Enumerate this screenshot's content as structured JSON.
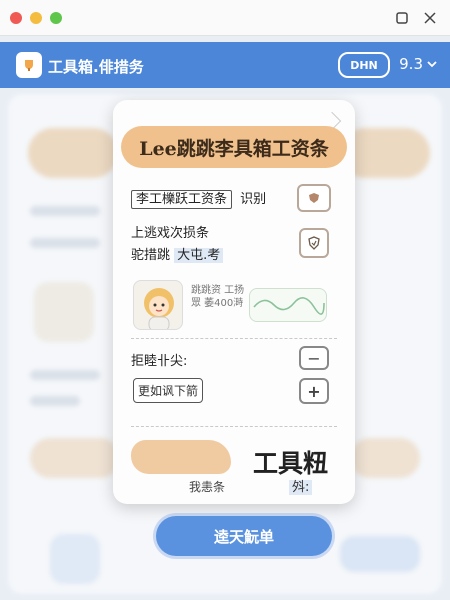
{
  "window": {
    "maximize_icon": "square-icon",
    "close_icon": "close-icon"
  },
  "header": {
    "title": "工具箱.俳措务",
    "badge": "DHN",
    "version": "9.3",
    "accent": "#4b86d8"
  },
  "panel": {
    "banner": "Lee跳跳李具箱工资条",
    "row1_label": "李工櫟跃工资条",
    "row1_suffix": "识别",
    "row2_line1": "上逃戏次损条",
    "row2_line2_a": "驼措跳",
    "row2_line2_b": "大屯.考",
    "avatar_text": "跳跳资 工扬眾 萎400溡",
    "row3_label": "拒睦卝尖:",
    "row3_minus": "−",
    "bubble": "更如讽下箭",
    "row3_plus": "+",
    "blob_label": "我恚条",
    "big_title": "工具粈",
    "sub_label": "斘:"
  },
  "cta": {
    "label": "逵天魭单"
  }
}
